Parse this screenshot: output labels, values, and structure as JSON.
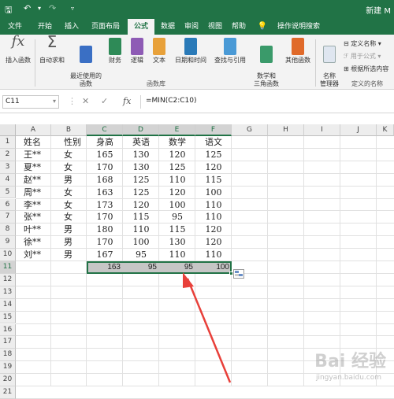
{
  "window": {
    "title": "新建 M"
  },
  "colors": {
    "brand": "#217346",
    "arrow": "#e8403a",
    "selection": "#c6c6c6"
  },
  "quick_access": {
    "save_icon": "save-icon",
    "undo_icon": "undo-icon",
    "redo_icon": "redo-icon",
    "customize_icon": "customize-icon"
  },
  "tabs": [
    "文件",
    "开始",
    "插入",
    "页面布局",
    "公式",
    "数据",
    "审阅",
    "视图",
    "帮助"
  ],
  "active_tab": "公式",
  "tell_me": "操作说明搜索",
  "ribbon": {
    "function_library": {
      "buttons": [
        "插入函数",
        "自动求和",
        "最近使用的\n函数",
        "财务",
        "逻辑",
        "文本",
        "日期和时间",
        "查找与引用",
        "数学和\n三角函数",
        "其他函数"
      ],
      "label": "函数库"
    },
    "name_manager": "名称\n管理器",
    "defined_names": {
      "items": [
        "定义名称",
        "用于公式",
        "根据所选内容"
      ],
      "label": "定义的名称"
    }
  },
  "formula_bar": {
    "name_box": "C11",
    "cancel": "✕",
    "confirm": "✓",
    "fx": "fx",
    "formula": "=MIN(C2:C10)"
  },
  "columns": [
    "A",
    "B",
    "C",
    "D",
    "E",
    "F",
    "G",
    "H",
    "I",
    "J",
    "K"
  ],
  "rows": [
    "1",
    "2",
    "3",
    "4",
    "5",
    "6",
    "7",
    "8",
    "9",
    "10",
    "11",
    "12",
    "13",
    "14",
    "15",
    "16",
    "17",
    "18",
    "19",
    "20",
    "21"
  ],
  "table": {
    "headers": [
      "姓名",
      "性别",
      "身高",
      "英语",
      "数学",
      "语文"
    ],
    "data": [
      [
        "王**",
        "女",
        "165",
        "130",
        "120",
        "125"
      ],
      [
        "夏**",
        "女",
        "170",
        "130",
        "125",
        "120"
      ],
      [
        "赵**",
        "男",
        "168",
        "125",
        "110",
        "115"
      ],
      [
        "周**",
        "女",
        "163",
        "125",
        "120",
        "100"
      ],
      [
        "李**",
        "女",
        "173",
        "120",
        "100",
        "110"
      ],
      [
        "张**",
        "女",
        "170",
        "115",
        "95",
        "110"
      ],
      [
        "叶**",
        "男",
        "180",
        "110",
        "115",
        "120"
      ],
      [
        "徐**",
        "男",
        "170",
        "100",
        "130",
        "120"
      ],
      [
        "刘**",
        "男",
        "167",
        "95",
        "110",
        "110"
      ]
    ],
    "min_row": [
      "163",
      "95",
      "95",
      "100"
    ]
  },
  "watermark": {
    "text": "Bai 经验",
    "sub": "jingyan.baidu.com"
  }
}
